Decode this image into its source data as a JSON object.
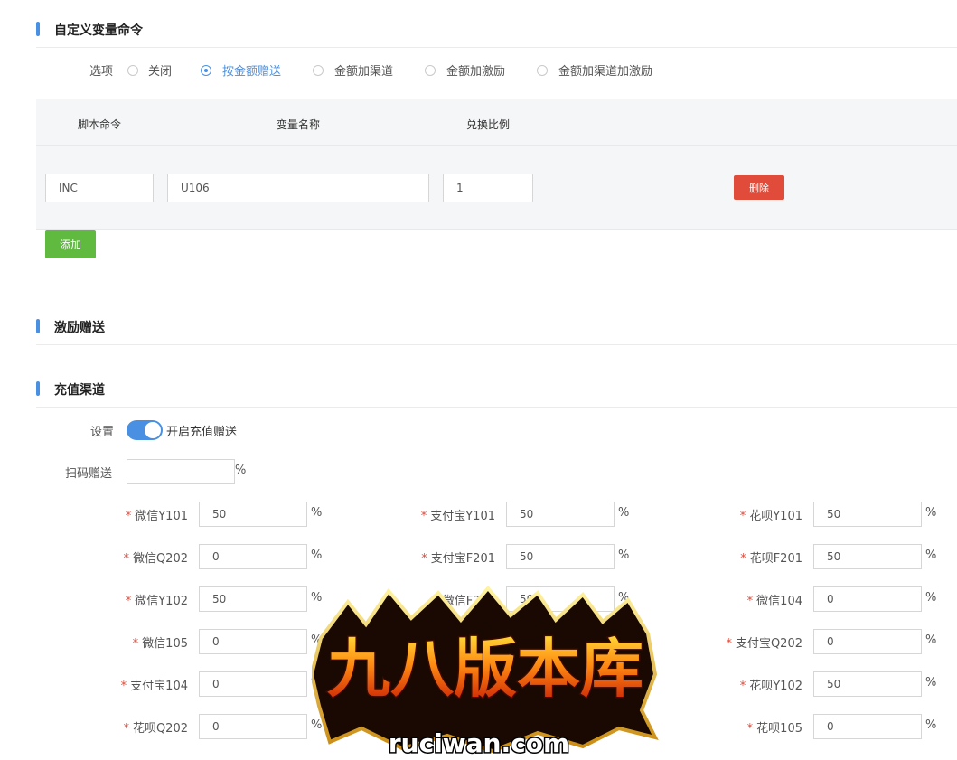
{
  "sections": {
    "custom_var": "自定义变量命令",
    "incentive": "激励赠送",
    "recharge": "充值渠道"
  },
  "options": {
    "label": "选项",
    "items": [
      {
        "label": "关闭",
        "checked": false
      },
      {
        "label": "按金额赠送",
        "checked": true
      },
      {
        "label": "金额加渠道",
        "checked": false
      },
      {
        "label": "金额加激励",
        "checked": false
      },
      {
        "label": "金额加渠道加激励",
        "checked": false
      }
    ]
  },
  "table": {
    "headers": [
      "脚本命令",
      "变量名称",
      "兑换比例"
    ],
    "row": {
      "command": "INC",
      "var_name": "U106",
      "ratio": "1"
    },
    "delete_label": "删除",
    "add_label": "添加"
  },
  "recharge": {
    "setting_label": "设置",
    "toggle_label": "开启充值赠送",
    "toggle_on": true,
    "scan_label": "扫码赠送",
    "scan_value": "",
    "percent": "%",
    "rows": [
      [
        {
          "label": "微信Y101",
          "value": "50"
        },
        {
          "label": "支付宝Y101",
          "value": "50"
        },
        {
          "label": "花呗Y101",
          "value": "50"
        }
      ],
      [
        {
          "label": "微信Q202",
          "value": "0"
        },
        {
          "label": "支付宝F201",
          "value": "50"
        },
        {
          "label": "花呗F201",
          "value": "50"
        }
      ],
      [
        {
          "label": "微信Y102",
          "value": "50"
        },
        {
          "label": "微信F201",
          "value": "50"
        },
        {
          "label": "微信104",
          "value": "0"
        }
      ],
      [
        {
          "label": "微信105",
          "value": "0"
        },
        {
          "label": "",
          "value": ""
        },
        {
          "label": "支付宝Q202",
          "value": "0"
        }
      ],
      [
        {
          "label": "支付宝104",
          "value": "0"
        },
        {
          "label": "",
          "value": ""
        },
        {
          "label": "花呗Y102",
          "value": "50"
        }
      ],
      [
        {
          "label": "花呗Q202",
          "value": "0"
        },
        {
          "label": "",
          "value": ""
        },
        {
          "label": "花呗105",
          "value": "0"
        }
      ]
    ]
  },
  "watermark": {
    "title": "九八版本库",
    "url": "ruciwan.com"
  },
  "colors": {
    "accent": "#4a90e2",
    "danger": "#e04b3a",
    "success": "#5fba3f"
  }
}
